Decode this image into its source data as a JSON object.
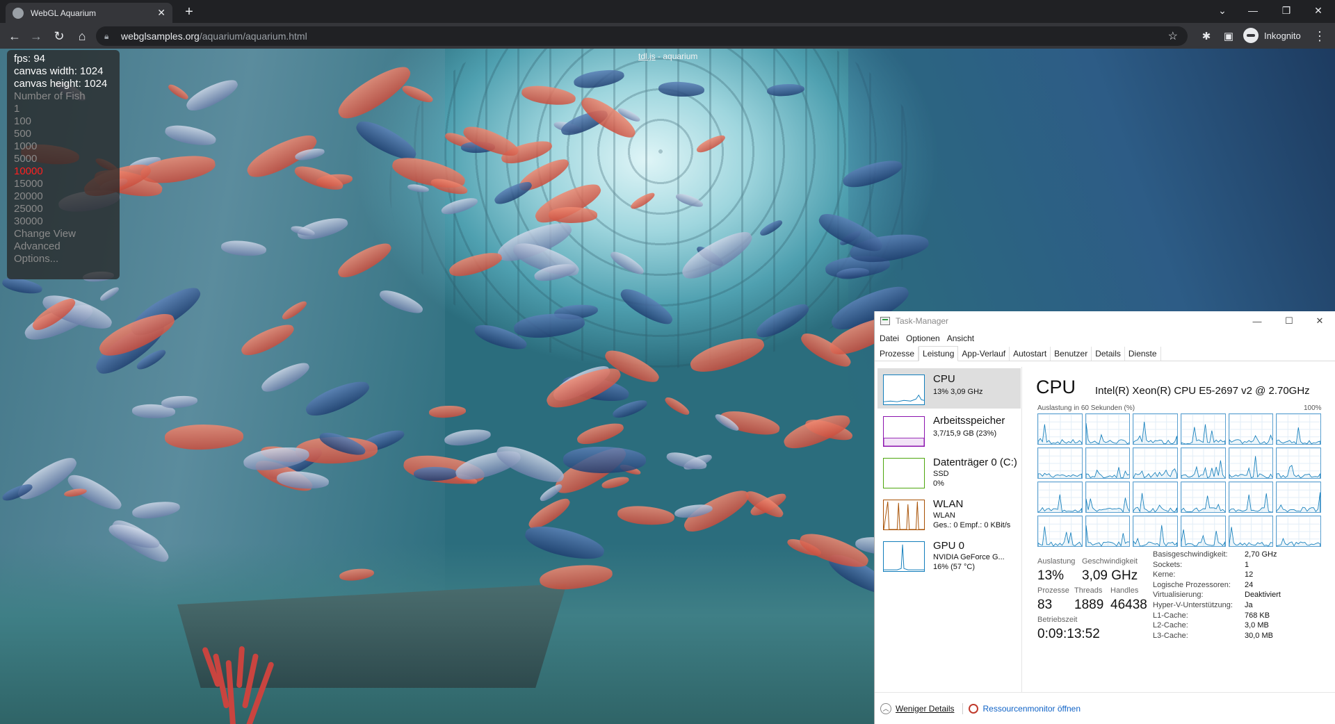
{
  "browser": {
    "tab_title": "WebGL Aquarium",
    "tab_close": "✕",
    "new_tab": "+",
    "url_host": "webglsamples.org",
    "url_path": "/aquarium/aquarium.html",
    "profile_label": "Inkognito",
    "icons": [
      "back-arrow-icon",
      "forward-arrow-icon",
      "reload-icon",
      "home-icon",
      "lock-icon",
      "star-icon",
      "extensions-icon",
      "sidepanel-icon",
      "incognito-icon",
      "menu-dots-icon"
    ]
  },
  "aquarium": {
    "title_link": "tdl.js",
    "title_sep": " - ",
    "title_name": "aquarium",
    "stats": [
      "fps: 94",
      "canvas width: 1024",
      "canvas height: 1024"
    ],
    "menu_header": "Number of Fish",
    "fish_options": [
      "1",
      "100",
      "500",
      "1000",
      "5000",
      "10000",
      "15000",
      "20000",
      "25000",
      "30000"
    ],
    "selected_fish": "10000",
    "extra_options": [
      "Change View",
      "Advanced",
      "Options..."
    ]
  },
  "taskmanager": {
    "title": "Task-Manager",
    "menu": [
      "Datei",
      "Optionen",
      "Ansicht"
    ],
    "tabs": [
      "Prozesse",
      "Leistung",
      "App-Verlauf",
      "Autostart",
      "Benutzer",
      "Details",
      "Dienste"
    ],
    "active_tab": "Leistung",
    "side": [
      {
        "name": "CPU",
        "sub1": "13% 3,09 GHz",
        "sub2": "",
        "color": "#117dbb"
      },
      {
        "name": "Arbeitsspeicher",
        "sub1": "3,7/15,9 GB (23%)",
        "sub2": "",
        "color": "#8b12ae"
      },
      {
        "name": "Datenträger 0 (C:)",
        "sub1": "SSD",
        "sub2": "0%",
        "color": "#4da60c"
      },
      {
        "name": "WLAN",
        "sub1": "WLAN",
        "sub2": "Ges.: 0 Empf.: 0 KBit/s",
        "color": "#a74f01"
      },
      {
        "name": "GPU 0",
        "sub1": "NVIDIA GeForce G...",
        "sub2": "16% (57 °C)",
        "color": "#117dbb"
      }
    ],
    "main_title": "CPU",
    "cpu_model": "Intel(R) Xeon(R) CPU E5-2697 v2 @ 2.70GHz",
    "graph_label": "Auslastung in 60 Sekunden (%)",
    "graph_max": "100%",
    "stats": {
      "util_label": "Auslastung",
      "util_value": "13%",
      "speed_label": "Geschwindigkeit",
      "speed_value": "3,09 GHz",
      "proc_label": "Prozesse",
      "proc_value": "83",
      "threads_label": "Threads",
      "threads_value": "1889",
      "handles_label": "Handles",
      "handles_value": "46438",
      "uptime_label": "Betriebszeit",
      "uptime_value": "0:09:13:52"
    },
    "specs": [
      {
        "k": "Basisgeschwindigkeit:",
        "v": "2,70 GHz"
      },
      {
        "k": "Sockets:",
        "v": "1"
      },
      {
        "k": "Kerne:",
        "v": "12"
      },
      {
        "k": "Logische Prozessoren:",
        "v": "24"
      },
      {
        "k": "Virtualisierung:",
        "v": "Deaktiviert"
      },
      {
        "k": "Hyper-V-Unterstützung:",
        "v": "Ja"
      },
      {
        "k": "L1-Cache:",
        "v": "768 KB"
      },
      {
        "k": "L2-Cache:",
        "v": "3,0 MB"
      },
      {
        "k": "L3-Cache:",
        "v": "30,0 MB"
      }
    ],
    "footer_fewer": "Weniger Details",
    "footer_resmon": "Ressourcenmonitor öffnen",
    "core_count": 24
  }
}
